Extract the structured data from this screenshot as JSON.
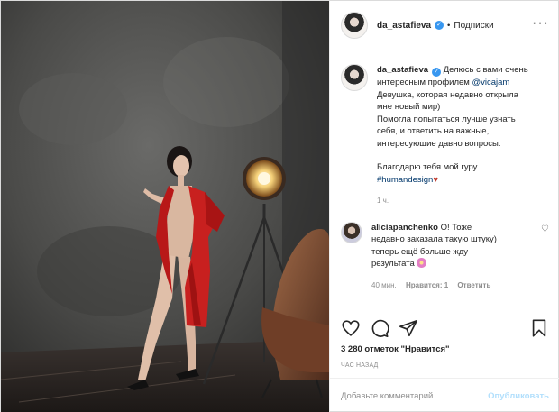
{
  "post": {
    "username": "da_astafieva",
    "follow_label": "Подписки",
    "separator": "•",
    "more_label": "···",
    "caption_lines": [
      "Делюсь с вами очень",
      "интересным профилем",
      "@vicajam",
      "Девушка, которая недавно открыла",
      "мне новый мир)",
      "Помогла попытаться лучше узнать",
      "себя, и ответить на важные,",
      "интересующие давно вопросы.",
      "Благодарю тебя мой гуру",
      "#humandesign"
    ],
    "caption_time": "1 ч."
  },
  "comment": {
    "username": "aliciapanchenko",
    "text_lines": [
      "О! Тоже",
      "недавно заказала такую штуку)",
      "теперь ещё больше жду",
      "результата"
    ],
    "time": "40 мин.",
    "likes": "Нравится: 1",
    "reply": "Ответить"
  },
  "actions": {
    "likes_text": "3 280 отметок \"Нравится\"",
    "time_ago": "ЧАС НАЗАД"
  },
  "add_comment": {
    "placeholder": "Добавьте комментарий...",
    "publish": "Опубликовать"
  },
  "colors": {
    "accent_link": "#00376b",
    "verified": "#3897f0",
    "publish_disabled": "#b2dffc",
    "dress": "#c8201f"
  }
}
